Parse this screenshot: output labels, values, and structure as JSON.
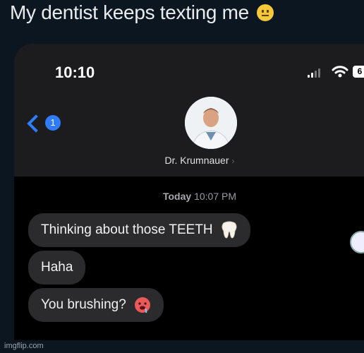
{
  "post": {
    "caption": "My dentist keeps texting me",
    "caption_emoji": "neutral-face-icon"
  },
  "status_bar": {
    "time": "10:10",
    "battery": "6"
  },
  "conversation": {
    "unread_count": "1",
    "contact_name": "Dr. Krumnauer",
    "timestamp_day": "Today",
    "timestamp_time": "10:07 PM"
  },
  "messages": [
    {
      "text": "Thinking about those TEETH",
      "emoji": "tooth-icon"
    },
    {
      "text": "Haha",
      "emoji": ""
    },
    {
      "text": "You brushing?",
      "emoji": "drooling-face-icon"
    }
  ],
  "watermark": "imgflip.com",
  "colors": {
    "accent": "#2f7cf6",
    "bubble": "#2b2b2e",
    "header_bg": "#1c1c1e",
    "page_bg": "#0c1620"
  }
}
